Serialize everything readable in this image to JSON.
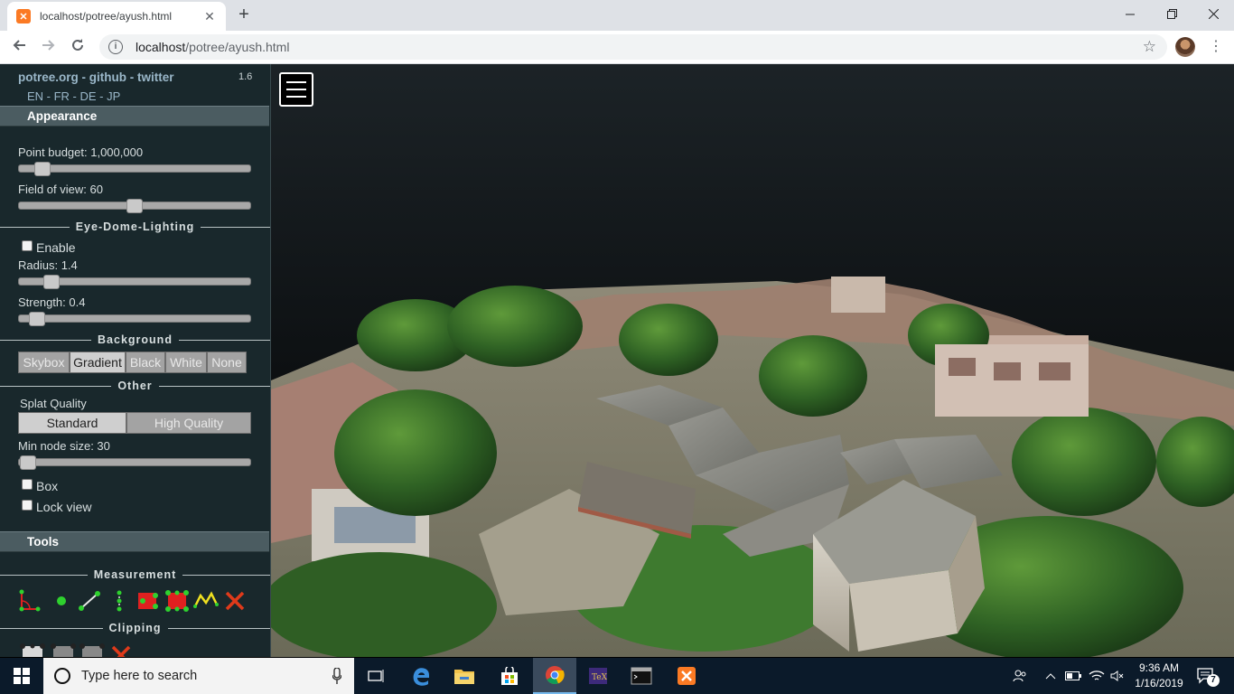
{
  "browser": {
    "tab_title": "localhost/potree/ayush.html",
    "tab_close": "✕",
    "new_tab": "+",
    "url_host": "localhost",
    "url_path": "/potree/ayush.html",
    "icons": [
      "back-icon",
      "forward-icon",
      "reload-icon",
      "info-icon",
      "star-icon",
      "menu-icon"
    ]
  },
  "sidebar": {
    "links": "potree.org - github - twitter",
    "version": "1.6",
    "languages": "EN - FR - DE - JP",
    "appearance": {
      "header": "Appearance",
      "point_budget_label": "Point budget: 1,000,000",
      "point_budget_level": 0.1,
      "fov_label": "Field of view: 60",
      "fov_level": 0.5,
      "edl_title": "Eye-Dome-Lighting",
      "edl_enable": "Enable",
      "radius_label": "Radius: 1.4",
      "radius_level": 0.14,
      "strength_label": "Strength: 0.4",
      "strength_level": 0.08,
      "background_title": "Background",
      "background_options": [
        "Skybox",
        "Gradient",
        "Black",
        "White",
        "None"
      ],
      "background_selected": "Gradient",
      "other_title": "Other",
      "splat_quality_label": "Splat Quality",
      "splat_options": [
        "Standard",
        "High Quality"
      ],
      "splat_selected": "Standard",
      "min_node_label": "Min node size: 30",
      "min_node_level": 0.02,
      "box_label": "Box",
      "lock_view_label": "Lock view"
    },
    "tools": {
      "header": "Tools",
      "measurement_title": "Measurement",
      "measurement_icons": [
        "angle-icon",
        "point-icon",
        "distance-icon",
        "height-icon",
        "circle-icon",
        "area-icon",
        "volume-icon",
        "profile-icon",
        "remove-icon"
      ],
      "clipping_title": "Clipping",
      "clipping_icons": [
        "clip-volume-icon",
        "clip-polygon-icon",
        "clip-screen-box-icon",
        "remove-clip-icon"
      ]
    }
  },
  "taskbar": {
    "search_placeholder": "Type here to search",
    "time": "9:36 AM",
    "date": "1/16/2019",
    "notification_count": "7",
    "apps": [
      "task-view-icon",
      "edge-icon",
      "file-explorer-icon",
      "store-icon",
      "chrome-icon",
      "texmaker-icon",
      "cmd-icon",
      "xampp-icon"
    ]
  }
}
